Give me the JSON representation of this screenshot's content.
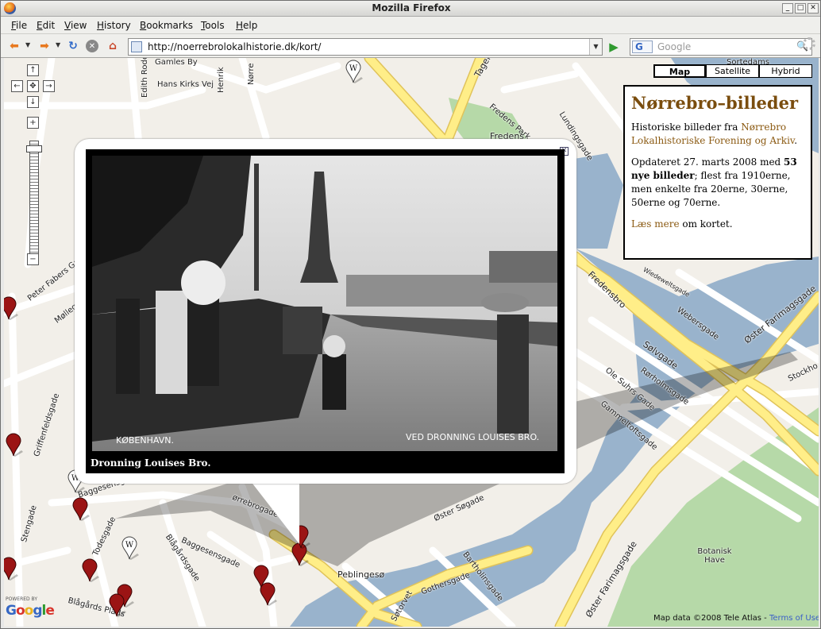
{
  "window": {
    "title": "Mozilla Firefox"
  },
  "menu": [
    "File",
    "Edit",
    "View",
    "History",
    "Bookmarks",
    "Tools",
    "Help"
  ],
  "nav": {
    "url": "http://noerrebrolokalhistorie.dk/kort/",
    "search_placeholder": "Google",
    "search_engine": "G"
  },
  "map": {
    "type_buttons": [
      "Map",
      "Satellite",
      "Hybrid"
    ],
    "active_type": "Map",
    "streets": {
      "gamles_by": "Gamles By",
      "hans_kirks": "Hans Kirks Vej",
      "edith_rode": "Edith Rode",
      "henrik": "Henrik",
      "norre": "Nørre",
      "tagens": "Tagens",
      "fredens_park": "Fredens Park",
      "lundings": "Lundingsgade",
      "fredens": "Fredens",
      "peter_fabers": "Peter Fabers Gade",
      "mollegade": "Møllegade",
      "griffenfeld": "Griffenfeldsgade",
      "baggesens1": "Baggesensgade",
      "baggesens2": "Baggesensgade",
      "stengade": "Stengade",
      "todesgade": "Todesgade",
      "blagards": "Blågårdsgade",
      "blagards_plads": "Blågårds Plads",
      "norrebrogade": "ørrebrogade",
      "peblingeso": "Peblingesø",
      "oster_sogade": "Øster Søgade",
      "bartholins": "Bartholinsgade",
      "gothers": "Gothersgade",
      "sotorvet": "Søtorvet",
      "botanisk": "Botanisk Have",
      "fredensbro": "Fredensbro",
      "webers": "Webersgade",
      "solvgade": "Sølvgade",
      "rorholms": "Rørholmsgade",
      "ole_suhrs": "Ole Suhrs Gade",
      "gammeltofts": "Gammeltoftsgade",
      "oster_farimag1": "Øster Farimagsgade",
      "oster_farimag2": "Øster Farimagsgade",
      "wiedewelt": "Wiedeweltsgade",
      "stockholm": "Stockho",
      "sortedams": "Sortedams"
    },
    "powered_by": "POWERED BY",
    "google_logo": "Google",
    "copyright": "Map data ©2008 Tele Atlas - ",
    "terms": "Terms of Use"
  },
  "panel": {
    "title": "Nørrebro–billeder",
    "p1_pre": "Historiske billeder fra ",
    "p1_link": "Nørrebro Lokalhistoriske Forening og Arkiv",
    "p1_post": ".",
    "p2_pre": "Opdateret 27. marts 2008 med ",
    "p2_bold": "53 nye billeder",
    "p2_post": "; flest fra 1910erne, men enkelte fra 20erne, 30erne, 50erne og 70erne.",
    "p3_link": "Læs mere",
    "p3_post": " om kortet."
  },
  "infowindow": {
    "caption": "Dronning Louises Bro.",
    "photo_text_left": "KØBENHAVN.",
    "photo_text_right": "VED DRONNING LOUISES BRO."
  },
  "colors": {
    "major_road": "#ffee88",
    "water": "#99b3cc",
    "park": "#b6d9a8",
    "pin": "#9b1414"
  }
}
